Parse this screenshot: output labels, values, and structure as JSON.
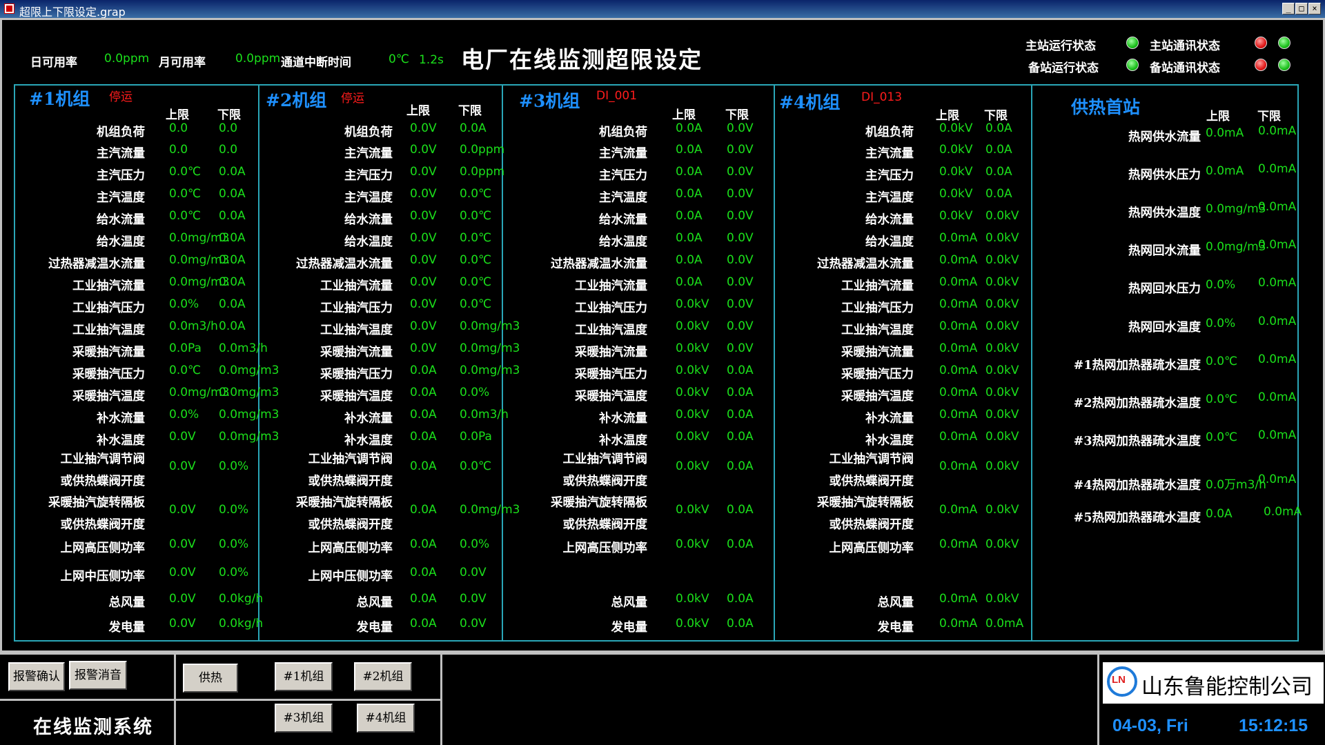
{
  "window": {
    "title": "超限上下限设定.grap",
    "controls": [
      "_",
      "□",
      "×"
    ]
  },
  "header": {
    "daily_avail_label": "日可用率",
    "daily_avail_value": "0.0ppm",
    "monthly_avail_label": "月可用率",
    "monthly_avail_value": "0.0ppm",
    "channel_interrupt_label": "通道中断时间",
    "channel_interrupt_temp": "0℃",
    "channel_interrupt_value": "1.2s",
    "page_title": "电厂在线监测超限设定"
  },
  "status": {
    "main_run_label": "主站运行状态",
    "main_comm_label": "主站通讯状态",
    "backup_run_label": "备站运行状态",
    "backup_comm_label": "备站通讯状态"
  },
  "colors": {
    "value": "#1be01b",
    "title": "#1e90ff",
    "alarm": "#ff1c1c",
    "frame": "#2aa7b8"
  },
  "col_headers": {
    "upper": "上限",
    "lower": "下限"
  },
  "units": [
    {
      "title": "#1机组",
      "status": "停运",
      "rows": [
        {
          "label": "机组负荷",
          "upper": "0.0",
          "lower": "0.0"
        },
        {
          "label": "主汽流量",
          "upper": "0.0",
          "lower": "0.0"
        },
        {
          "label": "主汽压力",
          "upper": "0.0℃",
          "lower": "0.0A"
        },
        {
          "label": "主汽温度",
          "upper": "0.0℃",
          "lower": "0.0A"
        },
        {
          "label": "给水流量",
          "upper": "0.0℃",
          "lower": "0.0A"
        },
        {
          "label": "给水温度",
          "upper": "0.0mg/m3",
          "lower": "0.0A"
        },
        {
          "label": "过热器减温水流量",
          "upper": "0.0mg/m3",
          "lower": "0.0A"
        },
        {
          "label": "工业抽汽流量",
          "upper": "0.0mg/m3",
          "lower": "0.0A"
        },
        {
          "label": "工业抽汽压力",
          "upper": "0.0%",
          "lower": "0.0A"
        },
        {
          "label": "工业抽汽温度",
          "upper": "0.0m3/h",
          "lower": "0.0A"
        },
        {
          "label": "采暖抽汽流量",
          "upper": "0.0Pa",
          "lower": "0.0m3/h"
        },
        {
          "label": "采暖抽汽压力",
          "upper": "0.0℃",
          "lower": "0.0mg/m3"
        },
        {
          "label": "采暖抽汽温度",
          "upper": "0.0mg/m3",
          "lower": "0.0mg/m3"
        },
        {
          "label": "补水流量",
          "upper": "0.0%",
          "lower": "0.0mg/m3"
        },
        {
          "label": "补水温度",
          "upper": "0.0V",
          "lower": "0.0mg/m3"
        },
        {
          "label": "工业抽汽调节阀",
          "label2": "或供热蝶阀开度",
          "upper": "0.0V",
          "lower": "0.0%"
        },
        {
          "label": "采暖抽汽旋转隔板",
          "label2": "或供热蝶阀开度",
          "upper": "0.0V",
          "lower": "0.0%"
        },
        {
          "label": "上网高压侧功率",
          "upper": "0.0V",
          "lower": "0.0%"
        },
        {
          "label": "上网中压侧功率",
          "upper": "0.0V",
          "lower": "0.0%"
        },
        {
          "label": "总风量",
          "upper": "0.0V",
          "lower": "0.0kg/h"
        },
        {
          "label": "发电量",
          "upper": "0.0V",
          "lower": "0.0kg/h"
        }
      ]
    },
    {
      "title": "#2机组",
      "status": "停运",
      "rows": [
        {
          "label": "机组负荷",
          "upper": "0.0V",
          "lower": "0.0A"
        },
        {
          "label": "主汽流量",
          "upper": "0.0V",
          "lower": "0.0ppm"
        },
        {
          "label": "主汽压力",
          "upper": "0.0V",
          "lower": "0.0ppm"
        },
        {
          "label": "主汽温度",
          "upper": "0.0V",
          "lower": "0.0℃"
        },
        {
          "label": "给水流量",
          "upper": "0.0V",
          "lower": "0.0℃"
        },
        {
          "label": "给水温度",
          "upper": "0.0V",
          "lower": "0.0℃"
        },
        {
          "label": "过热器减温水流量",
          "upper": "0.0V",
          "lower": "0.0℃"
        },
        {
          "label": "工业抽汽流量",
          "upper": "0.0V",
          "lower": "0.0℃"
        },
        {
          "label": "工业抽汽压力",
          "upper": "0.0V",
          "lower": "0.0℃"
        },
        {
          "label": "工业抽汽温度",
          "upper": "0.0V",
          "lower": "0.0mg/m3"
        },
        {
          "label": "采暖抽汽流量",
          "upper": "0.0V",
          "lower": "0.0mg/m3"
        },
        {
          "label": "采暖抽汽压力",
          "upper": "0.0A",
          "lower": "0.0mg/m3"
        },
        {
          "label": "采暖抽汽温度",
          "upper": "0.0A",
          "lower": "0.0%"
        },
        {
          "label": "补水流量",
          "upper": "0.0A",
          "lower": "0.0m3/h"
        },
        {
          "label": "补水温度",
          "upper": "0.0A",
          "lower": "0.0Pa"
        },
        {
          "label": "工业抽汽调节阀",
          "label2": "或供热蝶阀开度",
          "upper": "0.0A",
          "lower": "0.0℃"
        },
        {
          "label": "采暖抽汽旋转隔板",
          "label2": "或供热蝶阀开度",
          "upper": "0.0A",
          "lower": "0.0mg/m3"
        },
        {
          "label": "上网高压侧功率",
          "upper": "0.0A",
          "lower": "0.0%"
        },
        {
          "label": "上网中压侧功率",
          "upper": "0.0A",
          "lower": "0.0V"
        },
        {
          "label": "总风量",
          "upper": "0.0A",
          "lower": "0.0V"
        },
        {
          "label": "发电量",
          "upper": "0.0A",
          "lower": "0.0V"
        }
      ]
    },
    {
      "title": "#3机组",
      "status": "DI_001",
      "rows": [
        {
          "label": "机组负荷",
          "upper": "0.0A",
          "lower": "0.0V"
        },
        {
          "label": "主汽流量",
          "upper": "0.0A",
          "lower": "0.0V"
        },
        {
          "label": "主汽压力",
          "upper": "0.0A",
          "lower": "0.0V"
        },
        {
          "label": "主汽温度",
          "upper": "0.0A",
          "lower": "0.0V"
        },
        {
          "label": "给水流量",
          "upper": "0.0A",
          "lower": "0.0V"
        },
        {
          "label": "给水温度",
          "upper": "0.0A",
          "lower": "0.0V"
        },
        {
          "label": "过热器减温水流量",
          "upper": "0.0A",
          "lower": "0.0V"
        },
        {
          "label": "工业抽汽流量",
          "upper": "0.0A",
          "lower": "0.0V"
        },
        {
          "label": "工业抽汽压力",
          "upper": "0.0kV",
          "lower": "0.0V"
        },
        {
          "label": "工业抽汽温度",
          "upper": "0.0kV",
          "lower": "0.0V"
        },
        {
          "label": "采暖抽汽流量",
          "upper": "0.0kV",
          "lower": "0.0V"
        },
        {
          "label": "采暖抽汽压力",
          "upper": "0.0kV",
          "lower": "0.0A"
        },
        {
          "label": "采暖抽汽温度",
          "upper": "0.0kV",
          "lower": "0.0A"
        },
        {
          "label": "补水流量",
          "upper": "0.0kV",
          "lower": "0.0A"
        },
        {
          "label": "补水温度",
          "upper": "0.0kV",
          "lower": "0.0A"
        },
        {
          "label": "工业抽汽调节阀",
          "label2": "或供热蝶阀开度",
          "upper": "0.0kV",
          "lower": "0.0A"
        },
        {
          "label": "采暖抽汽旋转隔板",
          "label2": "或供热蝶阀开度",
          "upper": "0.0kV",
          "lower": "0.0A"
        },
        {
          "label": "上网高压侧功率",
          "upper": "0.0kV",
          "lower": "0.0A"
        },
        {
          "label": "总风量",
          "upper": "0.0kV",
          "lower": "0.0A"
        },
        {
          "label": "发电量",
          "upper": "0.0kV",
          "lower": "0.0A"
        }
      ]
    },
    {
      "title": "#4机组",
      "status": "DI_013",
      "rows": [
        {
          "label": "机组负荷",
          "upper": "0.0kV",
          "lower": "0.0A"
        },
        {
          "label": "主汽流量",
          "upper": "0.0kV",
          "lower": "0.0A"
        },
        {
          "label": "主汽压力",
          "upper": "0.0kV",
          "lower": "0.0A"
        },
        {
          "label": "主汽温度",
          "upper": "0.0kV",
          "lower": "0.0A"
        },
        {
          "label": "给水流量",
          "upper": "0.0kV",
          "lower": "0.0kV"
        },
        {
          "label": "给水温度",
          "upper": "0.0mA",
          "lower": "0.0kV"
        },
        {
          "label": "过热器减温水流量",
          "upper": "0.0mA",
          "lower": "0.0kV"
        },
        {
          "label": "工业抽汽流量",
          "upper": "0.0mA",
          "lower": "0.0kV"
        },
        {
          "label": "工业抽汽压力",
          "upper": "0.0mA",
          "lower": "0.0kV"
        },
        {
          "label": "工业抽汽温度",
          "upper": "0.0mA",
          "lower": "0.0kV"
        },
        {
          "label": "采暖抽汽流量",
          "upper": "0.0mA",
          "lower": "0.0kV"
        },
        {
          "label": "采暖抽汽压力",
          "upper": "0.0mA",
          "lower": "0.0kV"
        },
        {
          "label": "采暖抽汽温度",
          "upper": "0.0mA",
          "lower": "0.0kV"
        },
        {
          "label": "补水流量",
          "upper": "0.0mA",
          "lower": "0.0kV"
        },
        {
          "label": "补水温度",
          "upper": "0.0mA",
          "lower": "0.0kV"
        },
        {
          "label": "工业抽汽调节阀",
          "label2": "或供热蝶阀开度",
          "upper": "0.0mA",
          "lower": "0.0kV"
        },
        {
          "label": "采暖抽汽旋转隔板",
          "label2": "或供热蝶阀开度",
          "upper": "0.0mA",
          "lower": "0.0kV"
        },
        {
          "label": "上网高压侧功率",
          "upper": "0.0mA",
          "lower": "0.0kV"
        },
        {
          "label": "总风量",
          "upper": "0.0mA",
          "lower": "0.0kV"
        },
        {
          "label": "发电量",
          "upper": "0.0mA",
          "lower": "0.0mA"
        }
      ]
    }
  ],
  "heat_station": {
    "title": "供热首站",
    "rows": [
      {
        "label": "热网供水流量",
        "upper": "0.0mA",
        "lower": "0.0mA"
      },
      {
        "label": "热网供水压力",
        "upper": "0.0mA",
        "lower": "0.0mA"
      },
      {
        "label": "热网供水温度",
        "upper": "0.0mg/m3",
        "lower": "0.0mA"
      },
      {
        "label": "热网回水流量",
        "upper": "0.0mg/m3",
        "lower": "0.0mA"
      },
      {
        "label": "热网回水压力",
        "upper": "0.0%",
        "lower": "0.0mA"
      },
      {
        "label": "热网回水温度",
        "upper": "0.0%",
        "lower": "0.0mA"
      },
      {
        "label": "#1热网加热器疏水温度",
        "upper": "0.0℃",
        "lower": "0.0mA"
      },
      {
        "label": "#2热网加热器疏水温度",
        "upper": "0.0℃",
        "lower": "0.0mA"
      },
      {
        "label": "#3热网加热器疏水温度",
        "upper": "0.0℃",
        "lower": "0.0mA"
      },
      {
        "label": "#4热网加热器疏水温度",
        "upper": "0.0万m3/h",
        "lower": "0.0mA"
      },
      {
        "label": "#5热网加热器疏水温度",
        "upper": "0.0A",
        "lower": "0.0mA"
      }
    ]
  },
  "footer": {
    "alarm_ack": "报警确认",
    "alarm_silence": "报警消音",
    "heat_btn": "供热",
    "unit1_btn": "#1机组",
    "unit2_btn": "#2机组",
    "unit3_btn": "#3机组",
    "unit4_btn": "#4机组",
    "system_name": "在线监测系统",
    "company_logo": "LN",
    "company_name": "山东鲁能控制公司",
    "date": "04-03, Fri",
    "time": "15:12:15"
  }
}
